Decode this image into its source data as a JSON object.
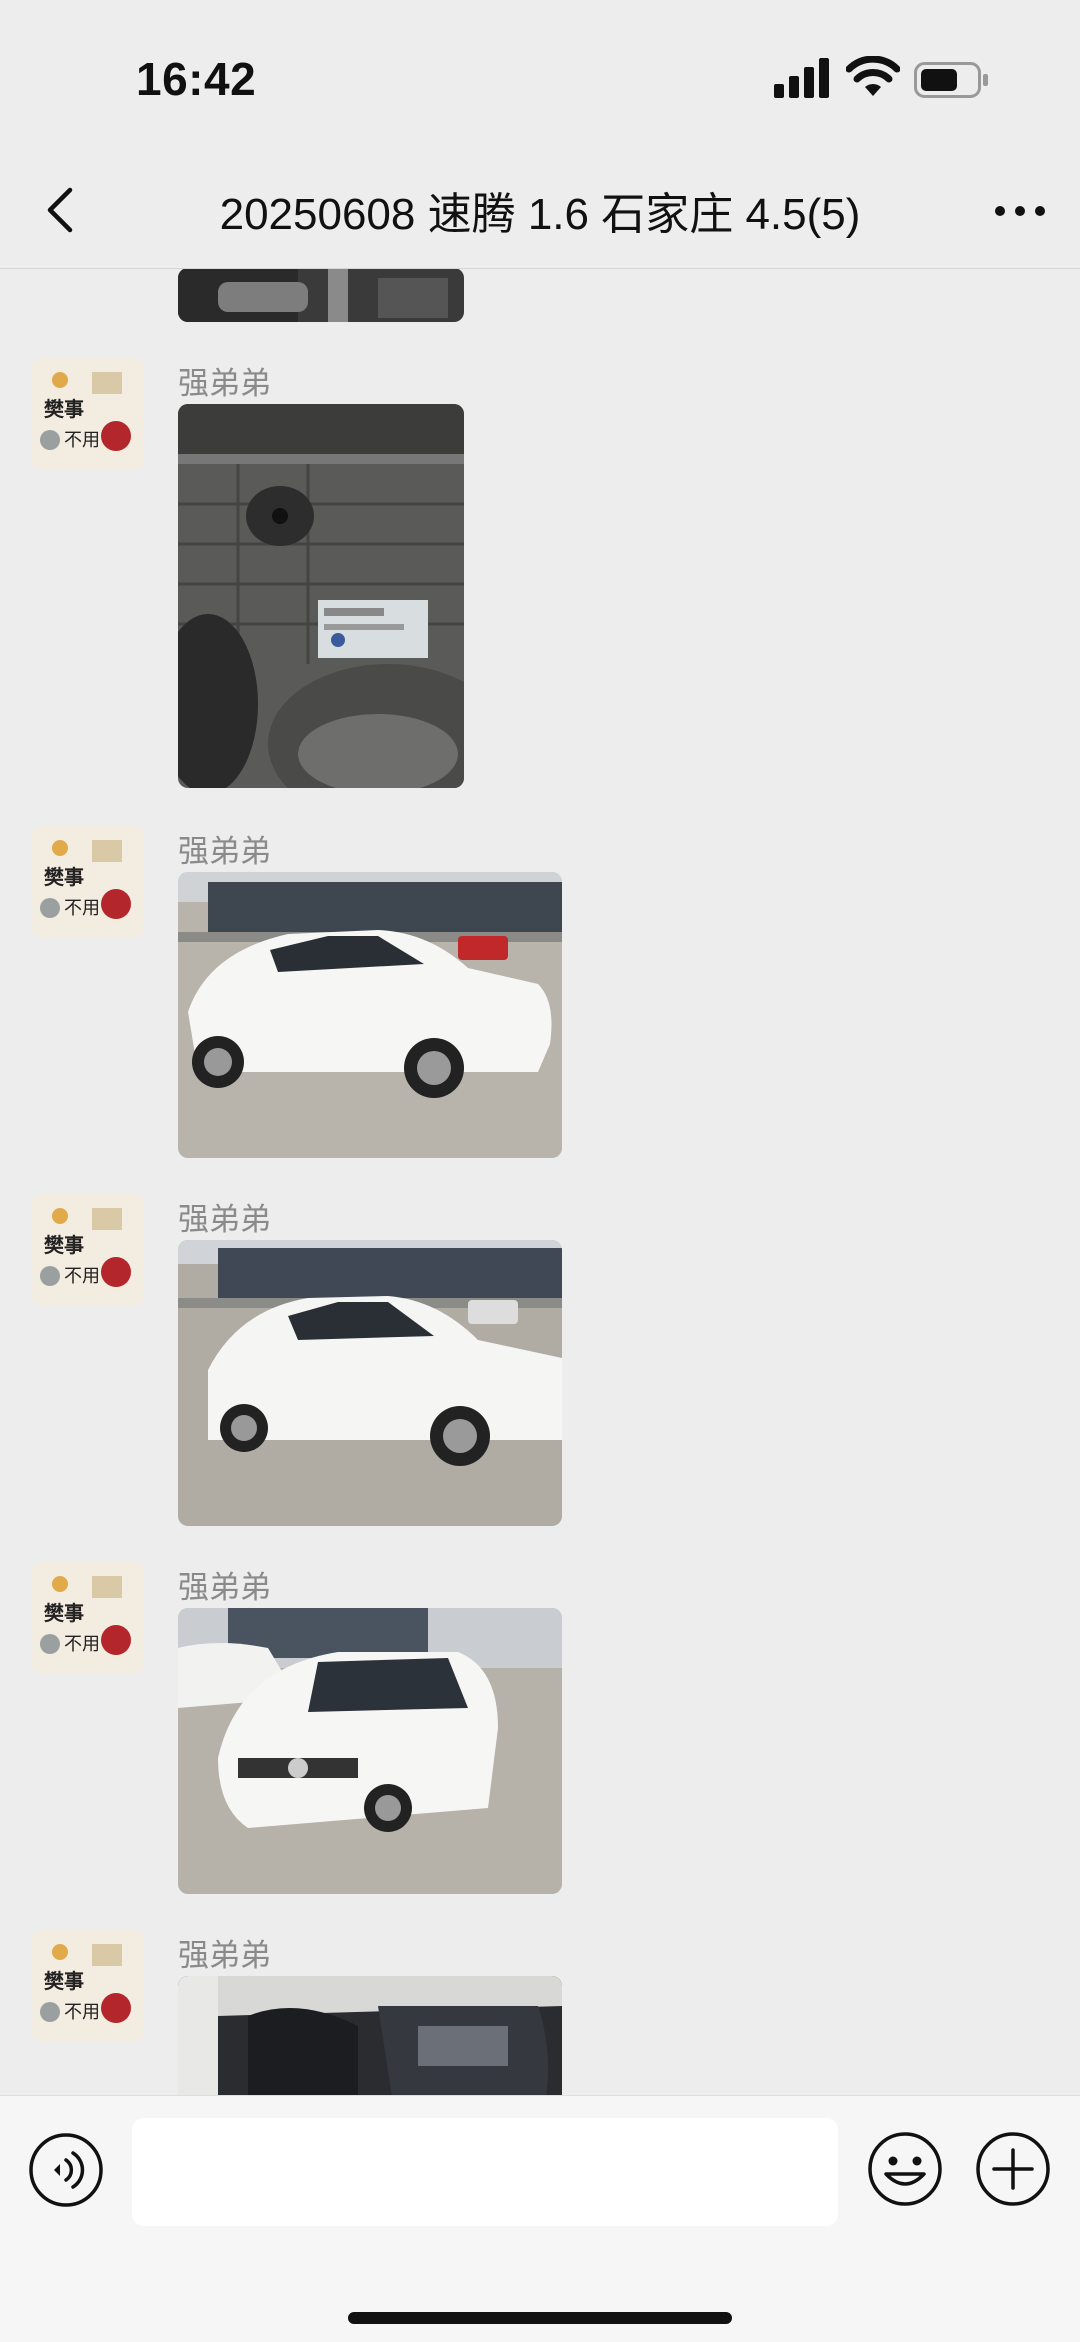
{
  "status_bar": {
    "time": "16:42",
    "signal_icon": "cellular-signal-icon",
    "wifi_icon": "wifi-icon",
    "battery_icon": "battery-icon"
  },
  "header": {
    "title": "20250608 速腾 1.6 石家庄 4.5(5)",
    "back_icon": "chevron-left-icon",
    "more_icon": "more-dots-icon"
  },
  "avatar": {
    "lines": [
      "樊事",
      "不用"
    ]
  },
  "messages": [
    {
      "sender": "强弟弟",
      "image": "engine-bay-label-photo"
    },
    {
      "sender": "强弟弟",
      "image": "white-sedan-side-photo"
    },
    {
      "sender": "强弟弟",
      "image": "white-sedan-side-photo-2"
    },
    {
      "sender": "强弟弟",
      "image": "white-sedan-front-photo"
    },
    {
      "sender": "强弟弟",
      "image": "car-interior-photo"
    }
  ],
  "input_bar": {
    "placeholder": "",
    "voice_icon": "voice-icon",
    "emoji_icon": "emoji-icon",
    "plus_icon": "plus-icon"
  },
  "colors": {
    "background": "#ededed",
    "input_bar": "#f6f6f6",
    "sender_text": "#8a8a8a"
  }
}
